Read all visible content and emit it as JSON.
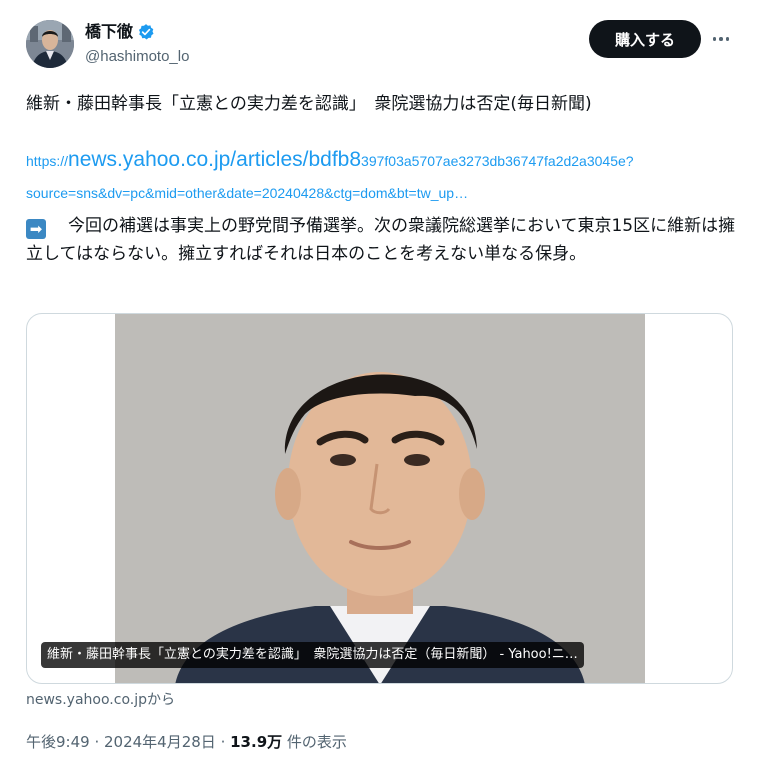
{
  "author": {
    "name": "橋下徹",
    "handle": "@hashimoto_lo",
    "verified": true,
    "avatar_icon": "profile-photo"
  },
  "header": {
    "buy_button": "購入する",
    "more_icon": "more-dots-icon"
  },
  "tweet": {
    "headline": "維新・藤田幹事長「立憲との実力差を認識」　衆院選協力は否定(毎日新聞)",
    "link_prefix": "https://",
    "link_domain_path": "news.yahoo.co.jp/articles/bdfb8",
    "link_rest": "397f03a5707ae3273db36747fa2d2a3045e?",
    "link_line2": "source=sns&dv=pc&mid=other&date=20240428&ctg=dom&bt=tw_up…",
    "arrow_emoji": "➡",
    "body": "今回の補選は事実上の野党間予備選挙。次の衆議院総選挙において東京15区に維新は擁立してはならない。擁立すればそれは日本のことを考えない単なる保身。"
  },
  "card": {
    "caption": "維新・藤田幹事長「立憲との実力差を認識」　衆院選協力は否定（毎日新聞） - Yahoo!ニ…",
    "source": "news.yahoo.co.jpから"
  },
  "meta": {
    "time": "午後9:49",
    "separator": " · ",
    "date": "2024年4月28日",
    "separator2": " · ",
    "views": "13.9万",
    "views_label": " 件の表示"
  },
  "colors": {
    "link": "#1d9bf0",
    "muted": "#536471",
    "button_bg": "#0f1419"
  }
}
